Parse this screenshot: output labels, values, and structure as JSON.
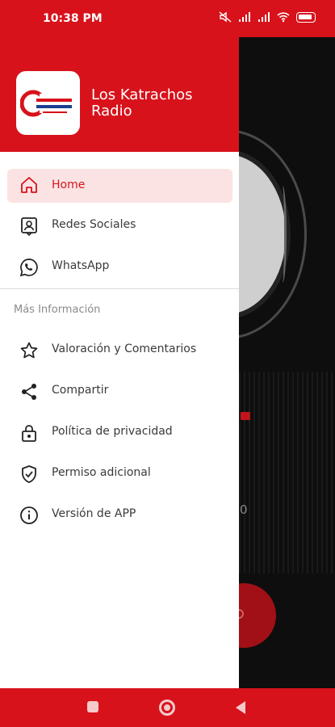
{
  "status_bar": {
    "time": "10:38 PM",
    "battery": "51"
  },
  "drawer": {
    "app_title": "Los Katrachos Radio",
    "logo_name": "los-katrachos-radio-logo",
    "primary_items": [
      {
        "label": "Home",
        "icon": "home-icon",
        "active": true
      },
      {
        "label": "Redes Sociales",
        "icon": "contact-card-icon",
        "active": false
      },
      {
        "label": "WhatsApp",
        "icon": "whatsapp-icon",
        "active": false
      }
    ],
    "section_title": "Más Información",
    "secondary_items": [
      {
        "label": "Valoración y Comentarios",
        "icon": "star-icon"
      },
      {
        "label": "Compartir",
        "icon": "share-icon"
      },
      {
        "label": "Política de privacidad",
        "icon": "lock-icon"
      },
      {
        "label": "Permiso adicional",
        "icon": "shield-check-icon"
      },
      {
        "label": "Versión de APP",
        "icon": "info-icon"
      }
    ]
  },
  "background_app": {
    "number_text": "0"
  },
  "colors": {
    "brand_red": "#d8121b",
    "active_bg": "#fbe3e4",
    "text": "#3a3a3a",
    "muted": "#8a8a8a"
  }
}
